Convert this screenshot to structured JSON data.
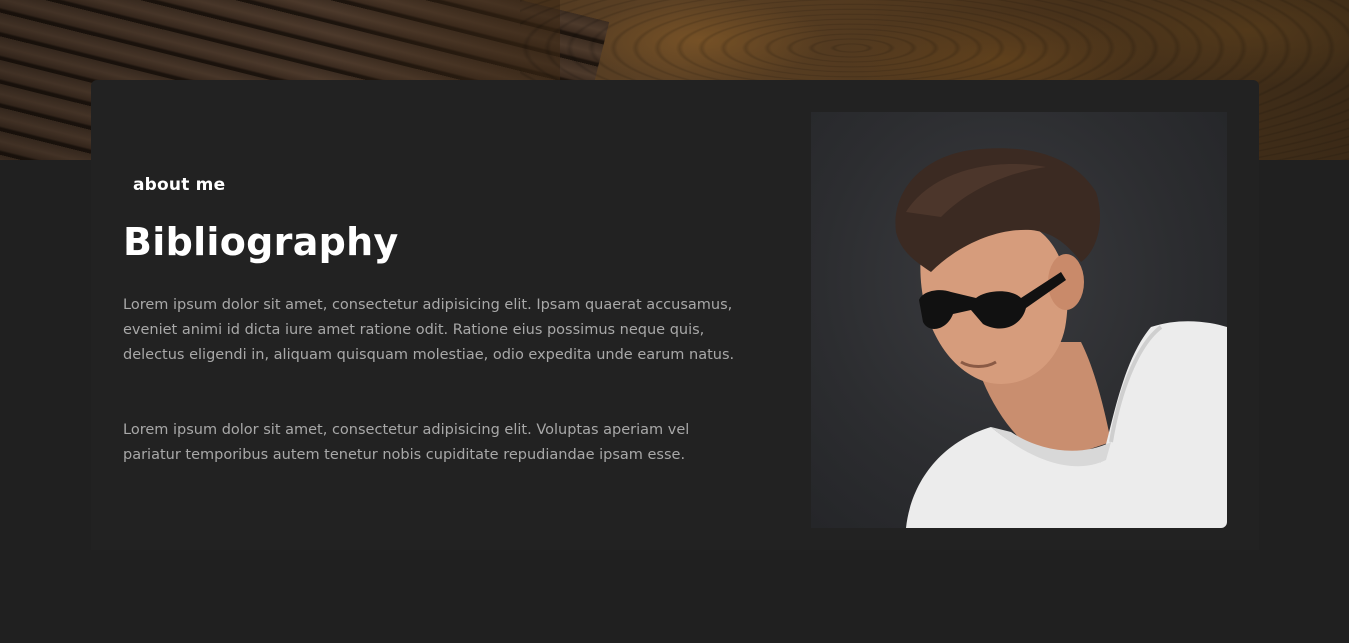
{
  "about": {
    "eyebrow": "about me",
    "title": "Bibliography",
    "paragraphs": [
      "Lorem ipsum dolor sit amet, consectetur adipisicing elit. Ipsam quaerat accusamus, eveniet animi id dicta iure amet ratione odit. Ratione eius possimus neque quis, delectus eligendi in, aliquam quisquam molestiae, odio expedita unde earum natus.",
      "Lorem ipsum dolor sit amet, consectetur adipisicing elit. Voluptas aperiam vel pariatur temporibus autem tenetur nobis cupiditate repudiandae ipsam esse."
    ]
  },
  "colors": {
    "page_background": "#202020",
    "card_background": "#222222",
    "heading_text": "#ffffff",
    "body_text": "#a8a8a8"
  }
}
